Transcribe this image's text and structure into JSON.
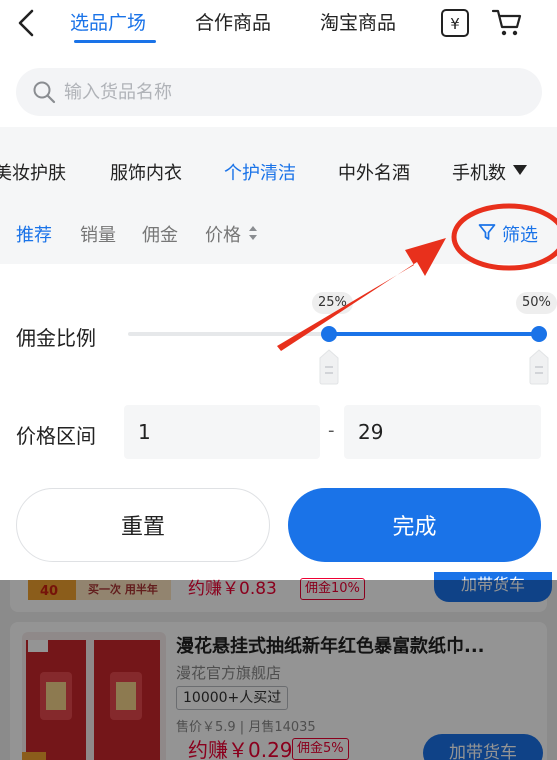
{
  "header": {
    "tabs": [
      {
        "label": "选品广场",
        "active": true
      },
      {
        "label": "合作商品",
        "active": false
      },
      {
        "label": "淘宝商品",
        "active": false
      }
    ],
    "icons": [
      "back-icon",
      "yen-icon",
      "cart-icon"
    ]
  },
  "search": {
    "placeholder": "输入货品名称",
    "value": ""
  },
  "categories": [
    {
      "label": "美妆护肤",
      "active": false
    },
    {
      "label": "服饰内衣",
      "active": false
    },
    {
      "label": "个护清洁",
      "active": true
    },
    {
      "label": "中外名酒",
      "active": false
    },
    {
      "label": "手机数",
      "active": false
    }
  ],
  "sort": {
    "options": [
      {
        "label": "推荐",
        "active": true
      },
      {
        "label": "销量",
        "active": false
      },
      {
        "label": "佣金",
        "active": false
      },
      {
        "label": "价格",
        "active": false
      }
    ],
    "filter_label": "筛选"
  },
  "filter_panel": {
    "commission_label": "佣金比例",
    "commission_min": "25%",
    "commission_max": "50%",
    "commission_range": [
      25,
      50
    ],
    "price_label": "价格区间",
    "price_min": "1",
    "price_separator": "-",
    "price_max": "29",
    "reset_label": "重置",
    "done_label": "完成"
  },
  "product_list": [
    {
      "promo_badge": "买一次 用半年",
      "earn": "约赚￥0.83",
      "commission_tag": "佣金10%",
      "add_label": "加带货车"
    },
    {
      "title": "漫花悬挂式抽纸新年红色暴富款纸巾...",
      "shop": "漫花官方旗舰店",
      "sold": "10000+人买过",
      "price_line": "售价￥5.9 | 月售14035",
      "earn": "约赚￥0.29",
      "commission_tag": "佣金5%",
      "add_label": "加带货车"
    }
  ],
  "colors": {
    "accent": "#1a73e8",
    "price": "#ee0033",
    "annotation": "#e8301c"
  }
}
